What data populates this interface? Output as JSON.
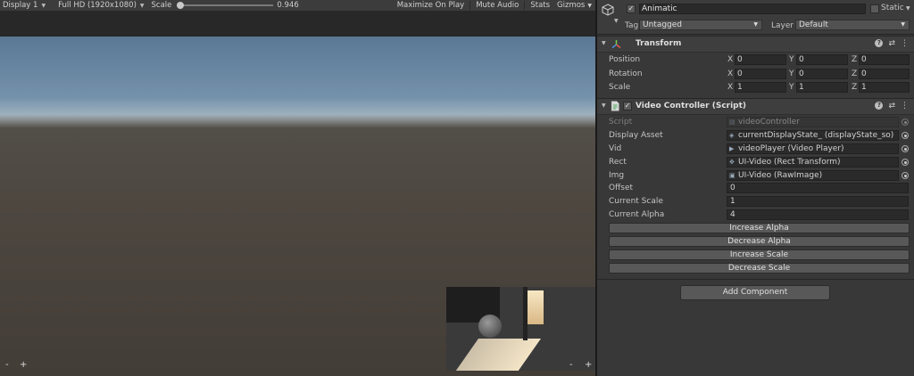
{
  "game_view": {
    "toolbar": {
      "display": "Display 1",
      "resolution": "Full HD (1920x1080)",
      "scale_label": "Scale",
      "scale_value": "0.946",
      "scale_fraction": 0.0,
      "maximize_on_play": "Maximize On Play",
      "mute_audio": "Mute Audio",
      "stats": "Stats",
      "gizmos": "Gizmos"
    },
    "zoom_minus": "-",
    "zoom_plus": "+",
    "preview_minus": "-",
    "preview_plus": "+"
  },
  "inspector": {
    "object": {
      "active": true,
      "name": "Animatic",
      "static_label": "Static",
      "static": false,
      "tag_label": "Tag",
      "tag": "Untagged",
      "layer_label": "Layer",
      "layer": "Default"
    },
    "transform": {
      "title": "Transform",
      "rows": [
        {
          "label": "Position",
          "x": "0",
          "y": "0",
          "z": "0"
        },
        {
          "label": "Rotation",
          "x": "0",
          "y": "0",
          "z": "0"
        },
        {
          "label": "Scale",
          "x": "1",
          "y": "1",
          "z": "1"
        }
      ],
      "axis": {
        "x": "X",
        "y": "Y",
        "z": "Z"
      }
    },
    "video_controller": {
      "enabled": true,
      "title": "Video Controller (Script)",
      "script_label": "Script",
      "script_value": "videoController",
      "display_asset_label": "Display Asset",
      "display_asset_value": "currentDisplayState_ (displayState_so)",
      "vid_label": "Vid",
      "vid_value": "videoPlayer (Video Player)",
      "rect_label": "Rect",
      "rect_value": "UI-Video (Rect Transform)",
      "img_label": "Img",
      "img_value": "UI-Video (RawImage)",
      "offset_label": "Offset",
      "offset_value": "0",
      "current_scale_label": "Current Scale",
      "current_scale_value": "1",
      "current_alpha_label": "Current Alpha",
      "current_alpha_value": "4",
      "buttons": {
        "increase_alpha": "Increase Alpha",
        "decrease_alpha": "Decrease Alpha",
        "increase_scale": "Increase Scale",
        "decrease_scale": "Decrease Scale"
      }
    },
    "add_component": "Add Component"
  }
}
